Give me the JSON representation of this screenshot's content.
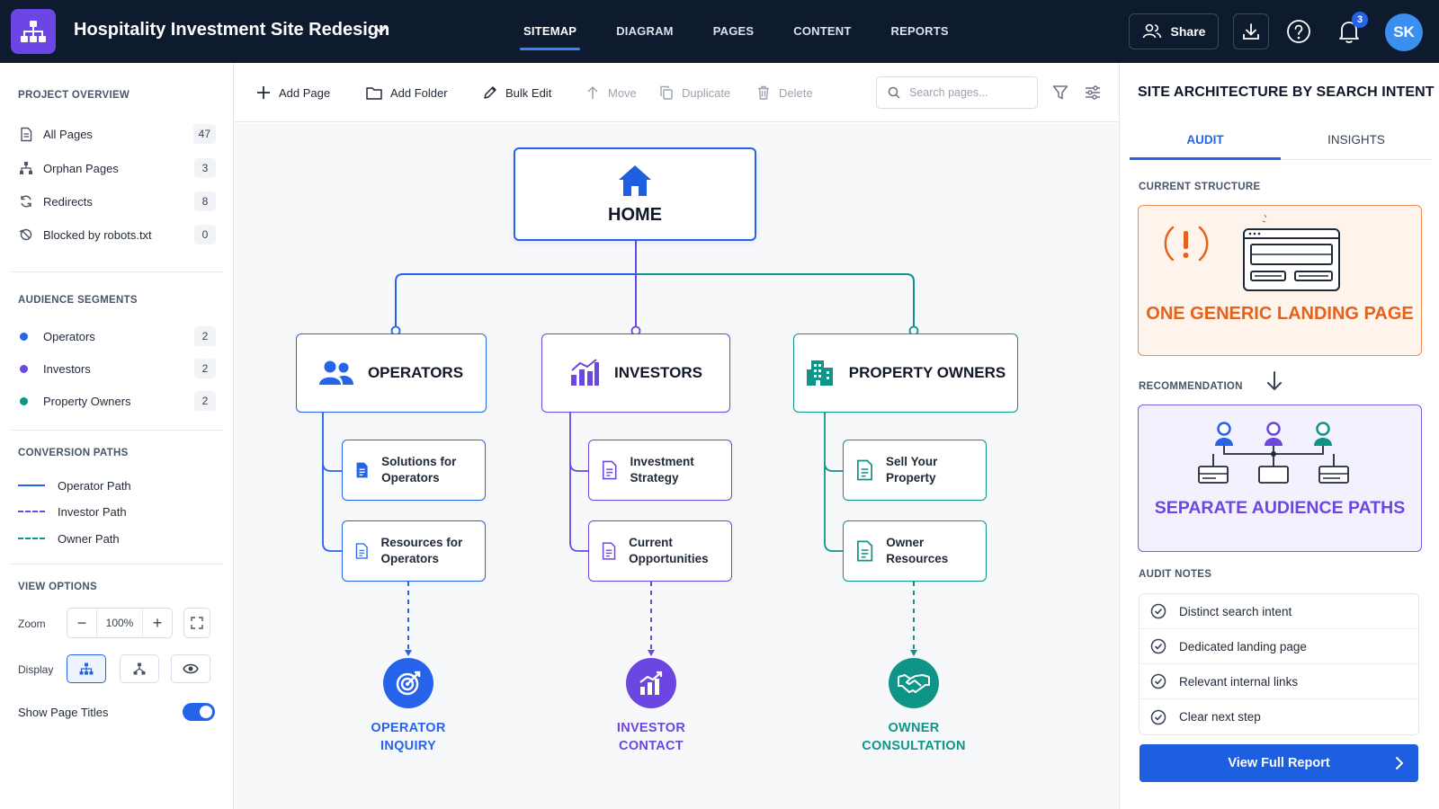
{
  "header": {
    "project_title": "Hospitality Investment Site Redesign",
    "nav": [
      "SITEMAP",
      "DIAGRAM",
      "PAGES",
      "CONTENT",
      "REPORTS"
    ],
    "active_nav": "SITEMAP",
    "share_label": "Share",
    "notification_count": "3",
    "avatar_initials": "SK"
  },
  "sidebar": {
    "overview_title": "PROJECT OVERVIEW",
    "overview": [
      {
        "label": "All Pages",
        "count": "47",
        "icon": "document-icon"
      },
      {
        "label": "Orphan Pages",
        "count": "3",
        "icon": "hierarchy-icon"
      },
      {
        "label": "Redirects",
        "count": "8",
        "icon": "redirect-icon"
      },
      {
        "label": "Blocked by robots.txt",
        "count": "0",
        "icon": "blocked-icon"
      }
    ],
    "segments_title": "AUDIENCE SEGMENTS",
    "segments": [
      {
        "label": "Operators",
        "count": "2",
        "color": "#2563eb"
      },
      {
        "label": "Investors",
        "count": "2",
        "color": "#6b46e0"
      },
      {
        "label": "Property Owners",
        "count": "2",
        "color": "#0f9488"
      }
    ],
    "paths_title": "CONVERSION PATHS",
    "paths": [
      {
        "label": "Operator Path",
        "color": "#2563eb",
        "style": "solid"
      },
      {
        "label": "Investor Path",
        "color": "#6b46e0",
        "style": "dashed"
      },
      {
        "label": "Owner Path",
        "color": "#0f9488",
        "style": "dashed"
      }
    ],
    "view_title": "VIEW OPTIONS",
    "zoom_label": "Zoom",
    "zoom_value": "100%",
    "display_label": "Display",
    "show_titles_label": "Show Page Titles",
    "show_titles_on": true
  },
  "toolbar": {
    "add_page": "Add Page",
    "add_folder": "Add Folder",
    "bulk_edit": "Bulk Edit",
    "move": "Move",
    "duplicate": "Duplicate",
    "delete": "Delete",
    "search_placeholder": "Search pages..."
  },
  "sitemap": {
    "home": "HOME",
    "segments": [
      {
        "label": "OPERATORS",
        "color": "#2563eb",
        "icon": "users-icon"
      },
      {
        "label": "INVESTORS",
        "color": "#6b46e0",
        "icon": "bar-chart-icon"
      },
      {
        "label": "PROPERTY OWNERS",
        "color": "#0f9488",
        "icon": "building-icon"
      }
    ],
    "pages": [
      [
        "Solutions for Operators",
        "Resources for Operators"
      ],
      [
        "Investment Strategy",
        "Current Opportunities"
      ],
      [
        "Sell Your Property",
        "Owner Resources"
      ]
    ],
    "goals": [
      {
        "label": "OPERATOR INQUIRY",
        "color": "#2563eb",
        "icon": "target-icon"
      },
      {
        "label": "INVESTOR CONTACT",
        "color": "#6b46e0",
        "icon": "growth-chart-icon"
      },
      {
        "label": "OWNER CONSULTATION",
        "color": "#0f9488",
        "icon": "handshake-icon"
      }
    ]
  },
  "panel": {
    "title": "SITE ARCHITECTURE BY SEARCH INTENT",
    "tabs": [
      "AUDIT",
      "INSIGHTS"
    ],
    "active_tab": "AUDIT",
    "current_title": "CURRENT STRUCTURE",
    "current_text": "ONE GENERIC LANDING PAGE",
    "rec_title": "RECOMMENDATION",
    "rec_text": "SEPARATE AUDIENCE PATHS",
    "notes_title": "AUDIT NOTES",
    "notes": [
      "Distinct search intent",
      "Dedicated landing page",
      "Relevant internal links",
      "Clear next step"
    ],
    "report_button": "View Full Report"
  }
}
